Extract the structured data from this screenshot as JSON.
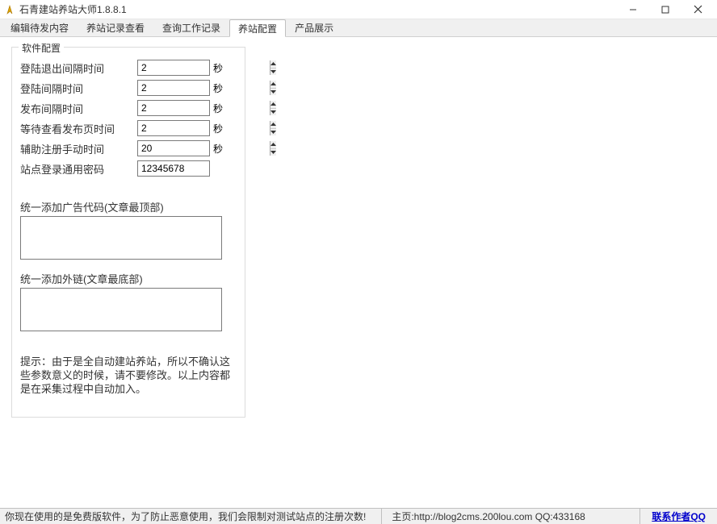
{
  "window": {
    "title": "石青建站养站大师1.8.8.1"
  },
  "tabs": [
    {
      "label": "编辑待发内容",
      "active": false
    },
    {
      "label": "养站记录查看",
      "active": false
    },
    {
      "label": "查询工作记录",
      "active": false
    },
    {
      "label": "养站配置",
      "active": true
    },
    {
      "label": "产品展示",
      "active": false
    }
  ],
  "config": {
    "legend": "软件配置",
    "rows": {
      "login_logout_interval": {
        "label": "登陆退出间隔时间",
        "value": "2",
        "unit": "秒"
      },
      "login_interval": {
        "label": "登陆间隔时间",
        "value": "2",
        "unit": "秒"
      },
      "publish_interval": {
        "label": "发布间隔时间",
        "value": "2",
        "unit": "秒"
      },
      "wait_view_time": {
        "label": "等待查看发布页时间",
        "value": "2",
        "unit": "秒"
      },
      "assist_register_time": {
        "label": "辅助注册手动时间",
        "value": "20",
        "unit": "秒"
      },
      "site_password": {
        "label": "站点登录通用密码",
        "value": "12345678"
      }
    },
    "ad_top_label": "统一添加广告代码(文章最顶部)",
    "ad_top_value": "",
    "extlink_label": "统一添加外链(文章最底部)",
    "extlink_value": "",
    "hint": "提示：由于是全自动建站养站，所以不确认这些参数意义的时候，请不要修改。以上内容都是在采集过程中自动加入。"
  },
  "statusbar": {
    "left": "你现在使用的是免费版软件，为了防止恶意使用，我们会限制对测试站点的注册次数!",
    "home": "主页:http://blog2cms.200lou.com QQ:433168",
    "contact": "联系作者QQ"
  }
}
